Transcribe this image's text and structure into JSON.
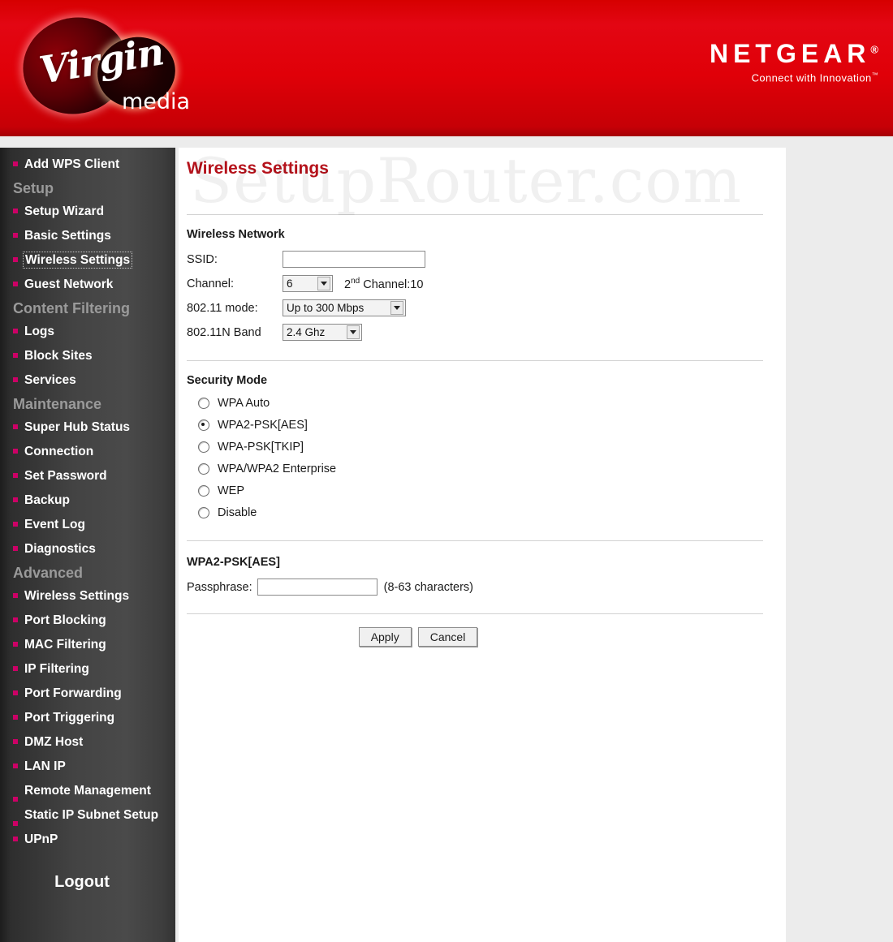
{
  "header": {
    "brand_left": {
      "wordmark": "Virgin",
      "sub": "media"
    },
    "brand_right": {
      "name": "NETGEAR",
      "trademark": "®",
      "tagline": "Connect with Innovation",
      "tagline_tm": "™"
    },
    "background_color": "#e30613"
  },
  "watermark": {
    "text": "SetupRouter.com"
  },
  "sidebar": {
    "background_color": "#434343",
    "bullet_color": "#cc0066",
    "items": [
      {
        "label": "Add WPS Client",
        "type": "link",
        "active": false
      },
      {
        "label": "Setup",
        "type": "group"
      },
      {
        "label": "Setup Wizard",
        "type": "link",
        "active": false
      },
      {
        "label": "Basic Settings",
        "type": "link",
        "active": false
      },
      {
        "label": "Wireless Settings",
        "type": "link",
        "active": true
      },
      {
        "label": "Guest Network",
        "type": "link",
        "active": false
      },
      {
        "label": "Content Filtering",
        "type": "group"
      },
      {
        "label": "Logs",
        "type": "link",
        "active": false
      },
      {
        "label": "Block Sites",
        "type": "link",
        "active": false
      },
      {
        "label": "Services",
        "type": "link",
        "active": false
      },
      {
        "label": "Maintenance",
        "type": "group"
      },
      {
        "label": "Super Hub Status",
        "type": "link",
        "active": false
      },
      {
        "label": "Connection",
        "type": "link",
        "active": false
      },
      {
        "label": "Set Password",
        "type": "link",
        "active": false
      },
      {
        "label": "Backup",
        "type": "link",
        "active": false
      },
      {
        "label": "Event Log",
        "type": "link",
        "active": false
      },
      {
        "label": "Diagnostics",
        "type": "link",
        "active": false
      },
      {
        "label": "Advanced",
        "type": "group"
      },
      {
        "label": "Wireless Settings",
        "type": "link",
        "active": false
      },
      {
        "label": "Port Blocking",
        "type": "link",
        "active": false
      },
      {
        "label": "MAC Filtering",
        "type": "link",
        "active": false
      },
      {
        "label": "IP Filtering",
        "type": "link",
        "active": false
      },
      {
        "label": "Port Forwarding",
        "type": "link",
        "active": false
      },
      {
        "label": "Port Triggering",
        "type": "link",
        "active": false
      },
      {
        "label": "DMZ Host",
        "type": "link",
        "active": false
      },
      {
        "label": "LAN IP",
        "type": "link",
        "active": false
      },
      {
        "label": "Remote Management",
        "type": "link",
        "active": false
      },
      {
        "label": "Static IP Subnet Setup",
        "type": "link",
        "active": false
      },
      {
        "label": "UPnP",
        "type": "link",
        "active": false
      }
    ],
    "logout_label": "Logout"
  },
  "main": {
    "page_title": "Wireless Settings",
    "title_color": "#b5121b",
    "wireless_network": {
      "section_title": "Wireless Network",
      "ssid_label": "SSID:",
      "ssid_value": "",
      "channel_label": "Channel:",
      "channel_value": "6",
      "second_channel_prefix": "2",
      "second_channel_sup": "nd",
      "second_channel_text": " Channel:10",
      "mode_label": "802.11 mode:",
      "mode_value": "Up to 300 Mbps",
      "band_label": "802.11N Band",
      "band_value": "2.4 Ghz"
    },
    "security_mode": {
      "section_title": "Security Mode",
      "options": [
        {
          "label": "WPA Auto",
          "selected": false
        },
        {
          "label": "WPA2-PSK[AES]",
          "selected": true
        },
        {
          "label": "WPA-PSK[TKIP]",
          "selected": false
        },
        {
          "label": "WPA/WPA2 Enterprise",
          "selected": false
        },
        {
          "label": "WEP",
          "selected": false
        },
        {
          "label": "Disable",
          "selected": false
        }
      ]
    },
    "passphrase_section": {
      "section_title": "WPA2-PSK[AES]",
      "passphrase_label": "Passphrase:",
      "passphrase_value": "",
      "hint": "(8-63 characters)"
    },
    "buttons": {
      "apply_label": "Apply",
      "cancel_label": "Cancel"
    }
  }
}
